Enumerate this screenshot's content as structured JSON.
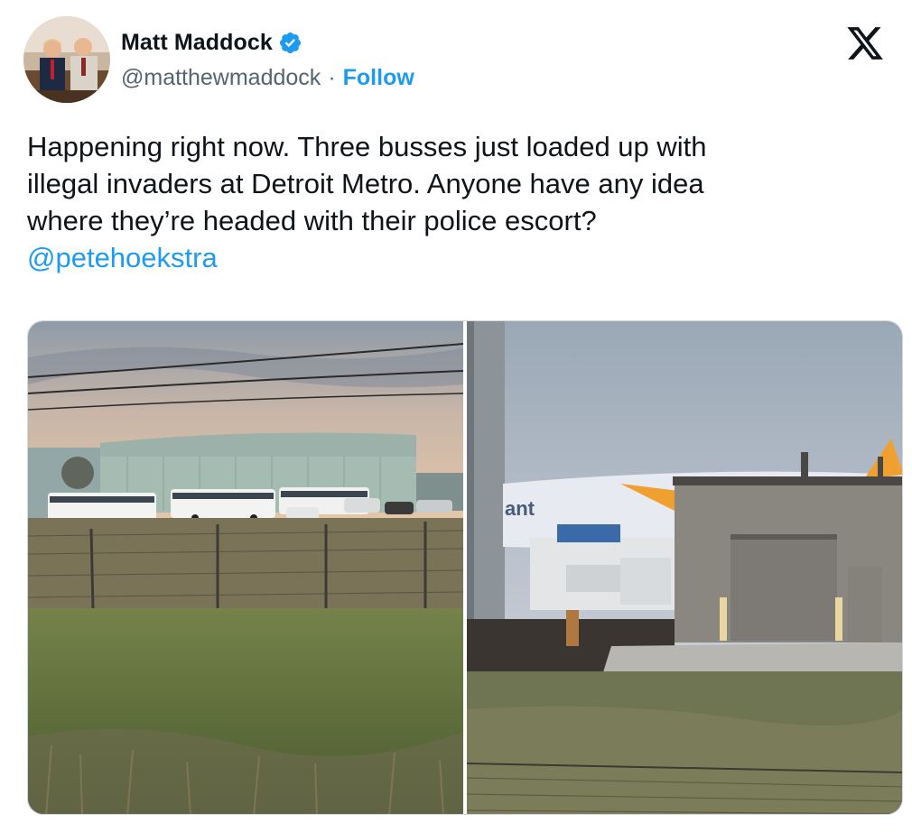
{
  "author": {
    "display_name": "Matt Maddock",
    "handle": "@matthewmaddock",
    "separator": "·",
    "follow_label": "Follow",
    "verified": true
  },
  "tweet": {
    "lines": [
      "Happening right now. Three busses just loaded up with",
      "illegal invaders at Detroit Metro. Anyone have any idea",
      "where they’re headed with their police escort?"
    ],
    "mention": "@petehoekstra"
  },
  "media": {
    "photos": [
      "airport-hangar-busses-photo",
      "airport-building-aircraft-photo"
    ],
    "right_photo_tail_text": "ant"
  },
  "colors": {
    "accent": "#1d9bf0",
    "text": "#0f1419",
    "secondary": "#536471",
    "border": "#cfd9de"
  }
}
